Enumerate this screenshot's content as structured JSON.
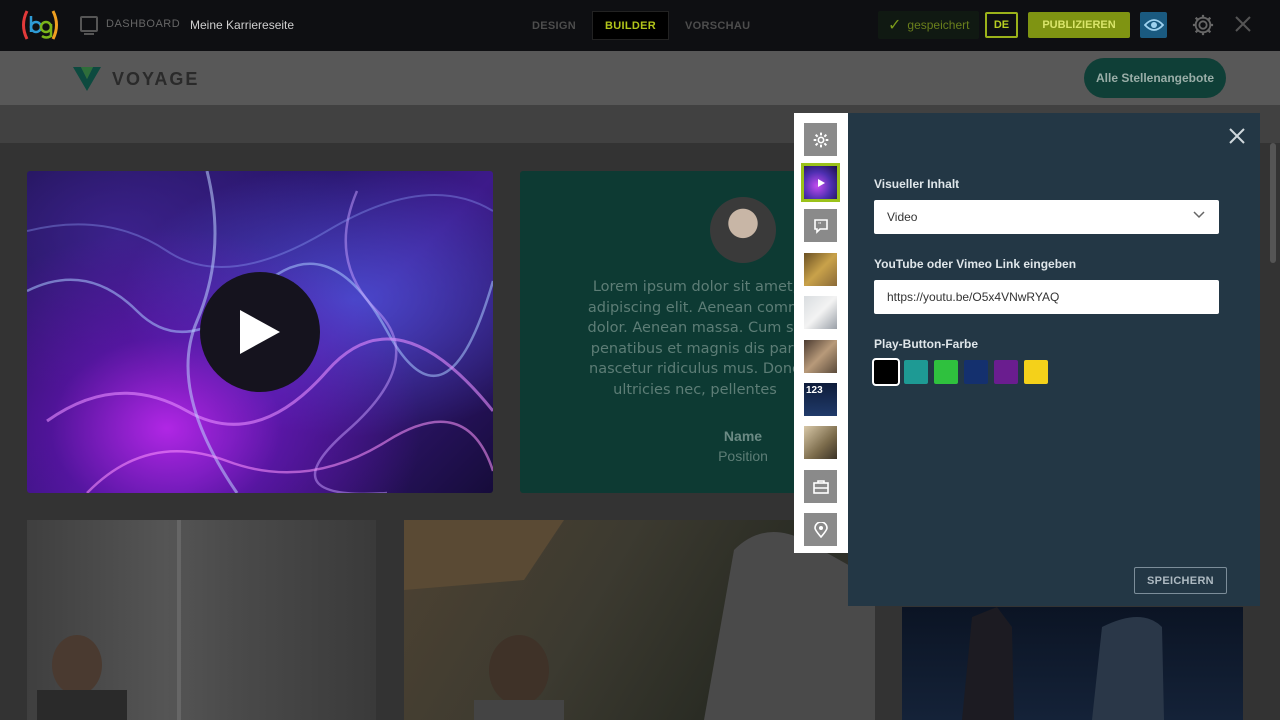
{
  "toolbar": {
    "logo_text": "bg",
    "dashboard_label": "DASHBOARD",
    "site_name": "Meine Karriereseite",
    "tabs": [
      {
        "label": "DESIGN",
        "active": false
      },
      {
        "label": "BUILDER",
        "active": true
      },
      {
        "label": "VORSCHAU",
        "active": false
      }
    ],
    "saved_label": "gespeichert",
    "language": "DE",
    "publish_label": "PUBLIZIEREN",
    "icons": [
      "preview-eye-icon",
      "settings-gear-icon",
      "close-icon"
    ]
  },
  "site": {
    "brand_name": "VOYAGE",
    "jobs_button": "Alle Stellenangebote",
    "quote": {
      "text": "Lorem ipsum dolor sit amet, adipiscing elit. Aenean comm dolor. Aenean massa. Cum so penatibus et magnis dis part nascetur ridiculus mus. Done ultricies nec, pellentes",
      "name": "Name",
      "position": "Position"
    }
  },
  "sidebar_thumbs": [
    {
      "name": "settings-gear-icon",
      "kind": "icon"
    },
    {
      "name": "video-thumb",
      "kind": "image",
      "selected": true
    },
    {
      "name": "quote-icon",
      "kind": "icon"
    },
    {
      "name": "image-thumb-1",
      "kind": "image"
    },
    {
      "name": "image-thumb-2",
      "kind": "image"
    },
    {
      "name": "image-thumb-3",
      "kind": "image"
    },
    {
      "name": "numbers-thumb",
      "kind": "image",
      "label": "123"
    },
    {
      "name": "image-thumb-4",
      "kind": "image"
    },
    {
      "name": "jobs-icon",
      "kind": "icon"
    },
    {
      "name": "location-pin-icon",
      "kind": "icon"
    }
  ],
  "editor": {
    "visual_label": "Visueller Inhalt",
    "visual_value": "Video",
    "link_label": "YouTube oder Vimeo Link eingeben",
    "link_value": "https://youtu.be/O5x4VNwRYAQ",
    "play_color_label": "Play-Button-Farbe",
    "colors": [
      "#000000",
      "#1e9a94",
      "#2fc13e",
      "#14306e",
      "#6a1d8f",
      "#f4d11a"
    ],
    "selected_color": "#000000",
    "save_label": "SPEICHERN"
  }
}
